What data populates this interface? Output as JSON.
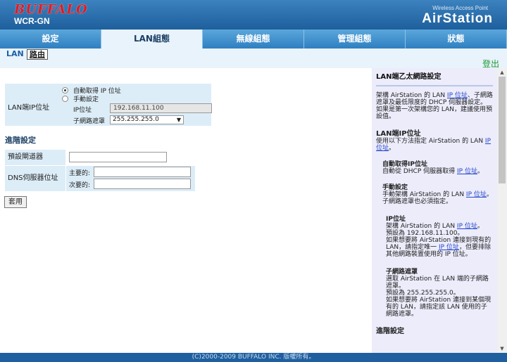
{
  "header": {
    "brand": "BUFFALO",
    "model": "WCR-GN",
    "subtitle": "Wireless Access Point",
    "product": "AirStation"
  },
  "main_nav": {
    "tabs": [
      {
        "label": "設定"
      },
      {
        "label": "LAN組態"
      },
      {
        "label": "無線組態"
      },
      {
        "label": "管理組態"
      },
      {
        "label": "狀態"
      }
    ]
  },
  "sub_nav": {
    "tabs": [
      {
        "label": "LAN"
      },
      {
        "label": "路由"
      }
    ],
    "logout": "登出"
  },
  "lan_ip": {
    "label": "LAN端IP位址",
    "options": [
      "自動取得 IP 位址",
      "手動設定"
    ],
    "ip_label": "IP位址",
    "ip_value": "192.168.11.100",
    "mask_label": "子網路遮罩",
    "mask_value": "255.255.255.0"
  },
  "advanced": {
    "title": "進階設定",
    "gateway_label": "預設閘道器",
    "gateway_value": "",
    "dns_label": "DNS伺服器位址",
    "primary_label": "主要的:",
    "primary_value": "",
    "secondary_label": "次要的:",
    "secondary_value": ""
  },
  "apply_button": "套用",
  "help": {
    "title": "LAN端乙太網路設定",
    "intro_1": "架構 AirStation 的 LAN ",
    "intro_link": "IP 位址",
    "intro_2": "、子網路遮罩及最低限度的 DHCP 伺服器設定。",
    "intro_3": "如果是第一次架構您的 LAN，建議使用預設值。",
    "lanip_title": "LAN端IP位址",
    "lanip_text_1": "使用以下方法指定 AirStation 的 LAN ",
    "lanip_link": "IP 位址",
    "lanip_text_2": "。",
    "auto_title": "自動取得IP位址",
    "auto_text_1": "自動從 DHCP 伺服器取得 ",
    "auto_link": "IP 位址",
    "auto_text_2": "。",
    "manual_title": "手動設定",
    "manual_text_1": "手動架構 AirStation 的 LAN ",
    "manual_link": "IP 位址",
    "manual_text_2": "。",
    "manual_text_3": "子網路遮罩也必須指定。",
    "ip_title": "IP位址",
    "ip_text_1": "架構 AirStation 的 LAN ",
    "ip_link_1": "IP 位址",
    "ip_text_2": "。",
    "ip_text_3": "預設為 192.168.11.100。",
    "ip_text_4": "如果想要將 AirStation 連接到現有的 LAN，請指定唯一 ",
    "ip_link_2": "IP 位址",
    "ip_text_5": "，但要排除其他網路裝置使用的 IP 位址。",
    "mask_title": "子網路遮罩",
    "mask_text_1": "選取 AirStation 在 LAN 端的子網路遮罩。",
    "mask_text_2": "預設為 255.255.255.0。",
    "mask_text_3": "如果想要將 AirStation 連接到某個現有的 LAN，請指定該 LAN 使用的子網路遮罩。",
    "adv_title": "進階設定"
  },
  "footer": "(C)2000-2009 BUFFALO INC. 版權所有。"
}
